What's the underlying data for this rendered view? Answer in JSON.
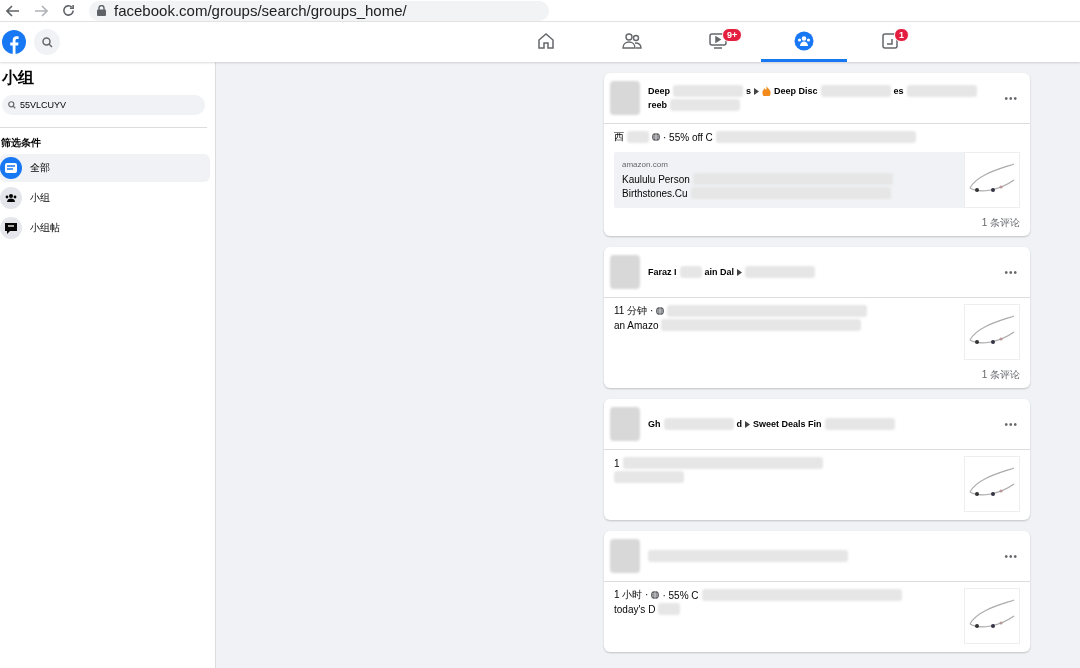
{
  "browser": {
    "url": "facebook.com/groups/search/groups_home/"
  },
  "nav": [
    {
      "kind": "home",
      "selected": false
    },
    {
      "kind": "friends",
      "selected": false
    },
    {
      "kind": "watch",
      "selected": false,
      "badge": "9+"
    },
    {
      "kind": "groups",
      "selected": true
    },
    {
      "kind": "gaming",
      "selected": false,
      "badge": "1"
    }
  ],
  "sidebar": {
    "title": "小组",
    "search": {
      "value": "55VLCUYV"
    },
    "filter_heading": "筛选条件",
    "filters": [
      {
        "kind": "all",
        "label": "全部",
        "selected": true
      },
      {
        "kind": "groups",
        "label": "小组",
        "selected": false
      },
      {
        "kind": "posts",
        "label": "小组帖",
        "selected": false
      }
    ]
  },
  "posts": [
    {
      "more": "•••",
      "header": [
        [
          {
            "kind": "text",
            "text": "Deep"
          },
          {
            "kind": "blur-short"
          },
          {
            "kind": "text",
            "text": "s"
          },
          {
            "kind": "arrow"
          },
          {
            "kind": "flame"
          },
          {
            "kind": "text",
            "text": "Deep Disc"
          },
          {
            "kind": "blur-short"
          },
          {
            "kind": "text",
            "text": "es"
          },
          {
            "kind": "blur-short"
          }
        ],
        [
          {
            "kind": "text",
            "text": "reeb"
          },
          {
            "kind": "blur-short"
          }
        ]
      ],
      "body": [
        [
          {
            "kind": "text",
            "text": "西"
          },
          {
            "kind": "blur-tiny"
          },
          {
            "kind": "globe"
          },
          {
            "kind": "text",
            "text": "· 55% off C"
          },
          {
            "kind": "blur-long"
          }
        ]
      ],
      "link": {
        "domain": "amazon.com",
        "lines": [
          [
            {
              "kind": "text",
              "text": "Kaululu Person"
            },
            {
              "kind": "blur-long"
            }
          ],
          [
            {
              "kind": "text",
              "text": "Birthstones.Cu"
            },
            {
              "kind": "blur-long"
            }
          ]
        ]
      },
      "footer": "1 条评论"
    },
    {
      "more": "•••",
      "header": [
        [
          {
            "kind": "text",
            "text": "Faraz I"
          },
          {
            "kind": "blur-tiny"
          },
          {
            "kind": "text",
            "text": "ain Dal"
          },
          {
            "kind": "arrow"
          },
          {
            "kind": "blur-short"
          }
        ]
      ],
      "body": [
        [
          {
            "kind": "text",
            "text": "11 分钟 ·"
          },
          {
            "kind": "globe"
          },
          {
            "kind": "blur-long"
          }
        ],
        [
          {
            "kind": "text",
            "text": "an Amazo"
          },
          {
            "kind": "blur-long"
          }
        ]
      ],
      "footer": "1 条评论"
    },
    {
      "more": "•••",
      "header": [
        [
          {
            "kind": "text",
            "text": "Gh"
          },
          {
            "kind": "blur-short"
          },
          {
            "kind": "text",
            "text": "d"
          },
          {
            "kind": "arrow"
          },
          {
            "kind": "text",
            "text": "Sweet Deals Fin"
          },
          {
            "kind": "blur-short"
          }
        ]
      ],
      "body": [
        [
          {
            "kind": "text",
            "text": "1"
          },
          {
            "kind": "blur-long"
          }
        ],
        [
          {
            "kind": "blur-short"
          }
        ]
      ]
    },
    {
      "more": "•••",
      "header": [
        [
          {
            "kind": "blur-long"
          }
        ]
      ],
      "body": [
        [
          {
            "kind": "text",
            "text": "1 小时 ·"
          },
          {
            "kind": "globe"
          },
          {
            "kind": "text",
            "text": "· 55% C"
          },
          {
            "kind": "blur-long"
          }
        ],
        [
          {
            "kind": "text",
            "text": "today's D"
          },
          {
            "kind": "blur-tiny"
          }
        ]
      ]
    }
  ]
}
